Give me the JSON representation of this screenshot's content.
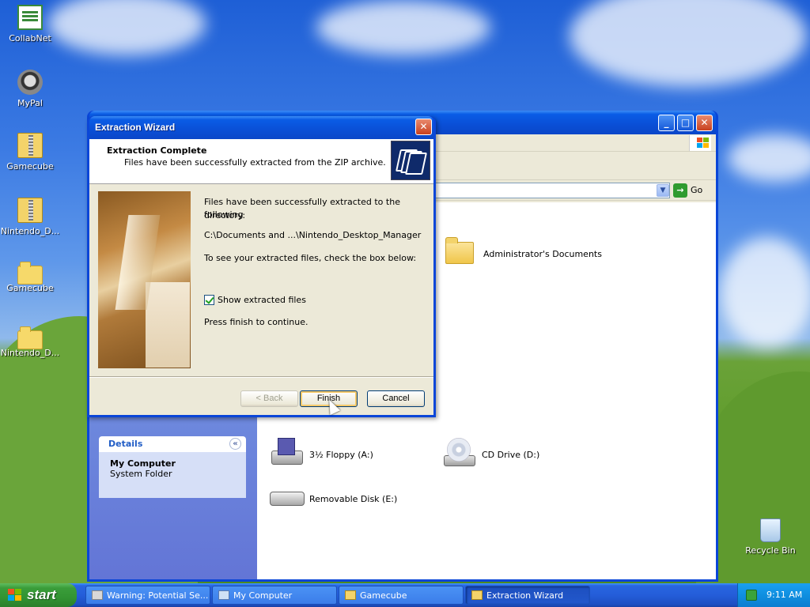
{
  "desktop": {
    "icons": [
      {
        "label": "CollabNet",
        "icon": "certificate-icon"
      },
      {
        "label": "MyPal",
        "icon": "raccoon-icon"
      },
      {
        "label": "Gamecube",
        "icon": "zip-folder-icon"
      },
      {
        "label": "Nintendo_D...",
        "icon": "zip-folder-icon"
      },
      {
        "label": "Gamecube",
        "icon": "folder-icon"
      },
      {
        "label": "Nintendo_D...",
        "icon": "folder-icon"
      },
      {
        "label": "Recycle Bin",
        "icon": "recycle-bin-icon"
      }
    ]
  },
  "explorer": {
    "go_label": "Go",
    "details": {
      "header": "Details",
      "title": "My Computer",
      "subtitle": "System Folder"
    },
    "items": [
      {
        "label": "Administrator's Documents",
        "icon": "folder-icon"
      },
      {
        "label": "3½ Floppy (A:)",
        "icon": "floppy-drive-icon"
      },
      {
        "label": "CD Drive (D:)",
        "icon": "cd-drive-icon"
      },
      {
        "label": "Removable Disk (E:)",
        "icon": "removable-disk-icon"
      }
    ]
  },
  "wizard": {
    "title": "Extraction Wizard",
    "header_title": "Extraction Complete",
    "header_subtitle": "Files have been successfully extracted from the ZIP archive.",
    "text_line1": "Files have been successfully extracted to the following",
    "text_line2": "directory:",
    "path": "C:\\Documents and ...\\Nintendo_Desktop_Manager",
    "check_prompt": "To see your extracted files, check the box below:",
    "checkbox_label": "Show extracted files",
    "checkbox_checked": true,
    "continue_text": "Press finish to continue.",
    "buttons": {
      "back": "< Back",
      "finish": "Finish",
      "cancel": "Cancel"
    }
  },
  "taskbar": {
    "start_label": "start",
    "tasks": [
      {
        "label": "Warning: Potential Se...",
        "icon": "warning-icon",
        "active": false
      },
      {
        "label": "My Computer",
        "icon": "computer-icon",
        "active": false
      },
      {
        "label": "Gamecube",
        "icon": "folder-icon",
        "active": false
      },
      {
        "label": "Extraction Wizard",
        "icon": "folder-icon",
        "active": true
      }
    ],
    "clock": "9:11 AM"
  },
  "colors": {
    "titlebar_blue": "#0a46d8",
    "taskbar_blue": "#245dd9",
    "start_green": "#3a9d3a",
    "dialog_bg": "#ece9d8"
  }
}
